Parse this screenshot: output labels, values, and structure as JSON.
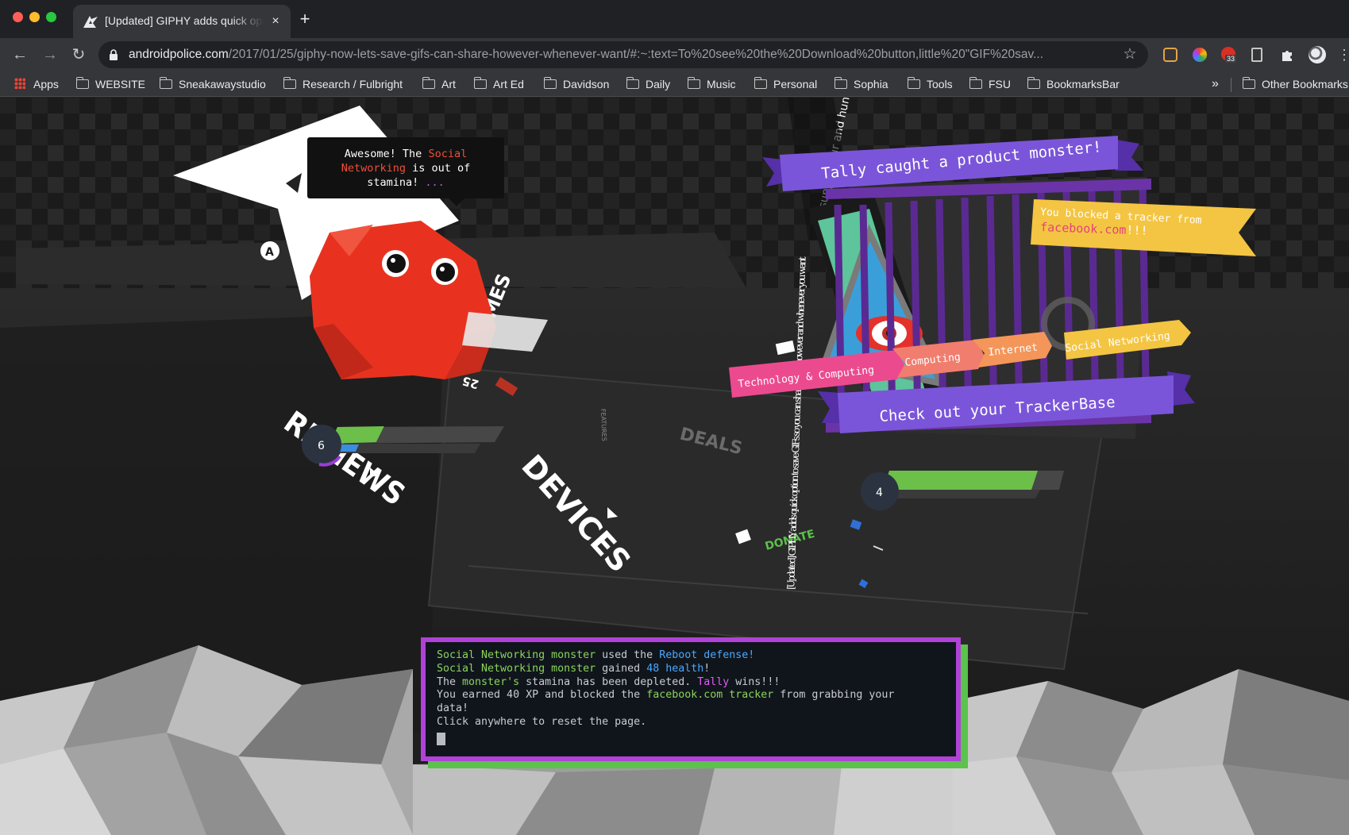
{
  "tab": {
    "title": "[Updated] GIPHY adds quick option to save GIFs so you can share them however and whenever you want",
    "close": "×",
    "new_tab": "+"
  },
  "toolbar": {
    "back": "←",
    "forward": "→",
    "reload": "↻",
    "url_host": "androidpolice.com",
    "url_path": "/2017/01/25/giphy-now-lets-save-gifs-can-share-however-whenever-want/#:~:text=To%20see%20the%20Download%20button,little%20\"GIF%20sav...",
    "star": "☆",
    "extension_badge": "33"
  },
  "bookmarks": {
    "items": [
      "Apps",
      "WEBSITE",
      "Sneakawaystudio",
      "Research / Fulbright",
      "Art",
      "Art Ed",
      "Davidson",
      "Daily",
      "Music",
      "Personal",
      "Sophia",
      "Tools",
      "FSU",
      "BookmarksBar"
    ],
    "overflow": "»",
    "other": "Other Bookmarks"
  },
  "speech": {
    "part1": "Awesome! The ",
    "highlight": "Social Networking",
    "part2": " is out of stamina! ",
    "dots": "..."
  },
  "scene": {
    "reviews": "REVIEWS",
    "devices": "DEVICES",
    "deals": "DEALS",
    "features": "FEATURES",
    "games": "GAMES",
    "donate": "DONATE",
    "number_25": "25",
    "player_level": "6",
    "monster_level": "4",
    "article_title": "[Updated] GIPHY adds quick option to save GIFs so you can share them however and whenever you want",
    "support_text": "support our and hundreds of and stay ad-fr Join S",
    "badge_glyph": "A"
  },
  "tally": {
    "caught": "Tally caught a product monster!",
    "blocked_line1": "You blocked a tracker from",
    "blocked_domain": "facebook.com",
    "blocked_suffix": "!!!",
    "tags": [
      "Technology & Computing",
      "Computing",
      "Internet",
      "Social Networking"
    ],
    "trackerbase": "Check out your TrackerBase"
  },
  "console": {
    "l1a": "Social Networking monster",
    "l1b": " used the ",
    "l1c": "Reboot defense",
    "l1d": "!",
    "l2a": "Social Networking monster",
    "l2b": " gained ",
    "l2c": "48 health",
    "l2d": "!",
    "l3a": "The ",
    "l3b": "monster's",
    "l3c": " stamina has been depleted. ",
    "l3d": "Tally",
    "l3e": " wins!!!",
    "l4a": "You earned 40 XP and blocked the ",
    "l4b": "facebook.com tracker",
    "l4c": " from grabbing your",
    "l5": "data!",
    "l6": "Click anywhere to reset the page."
  },
  "colors": {
    "monster_red": "#e8321f",
    "banner_purple": "#7b55d9",
    "banner_yellow": "#f4c542",
    "tag_pink": "#ec4a8f",
    "tag_coral": "#f07d6e",
    "tag_orange": "#f4965a",
    "console_border": "#b042d8",
    "console_shadow": "#5bc24b",
    "health_green": "#6cc04a"
  },
  "health": {
    "player_fraction": 0.28,
    "monster_fraction": 0.85
  }
}
